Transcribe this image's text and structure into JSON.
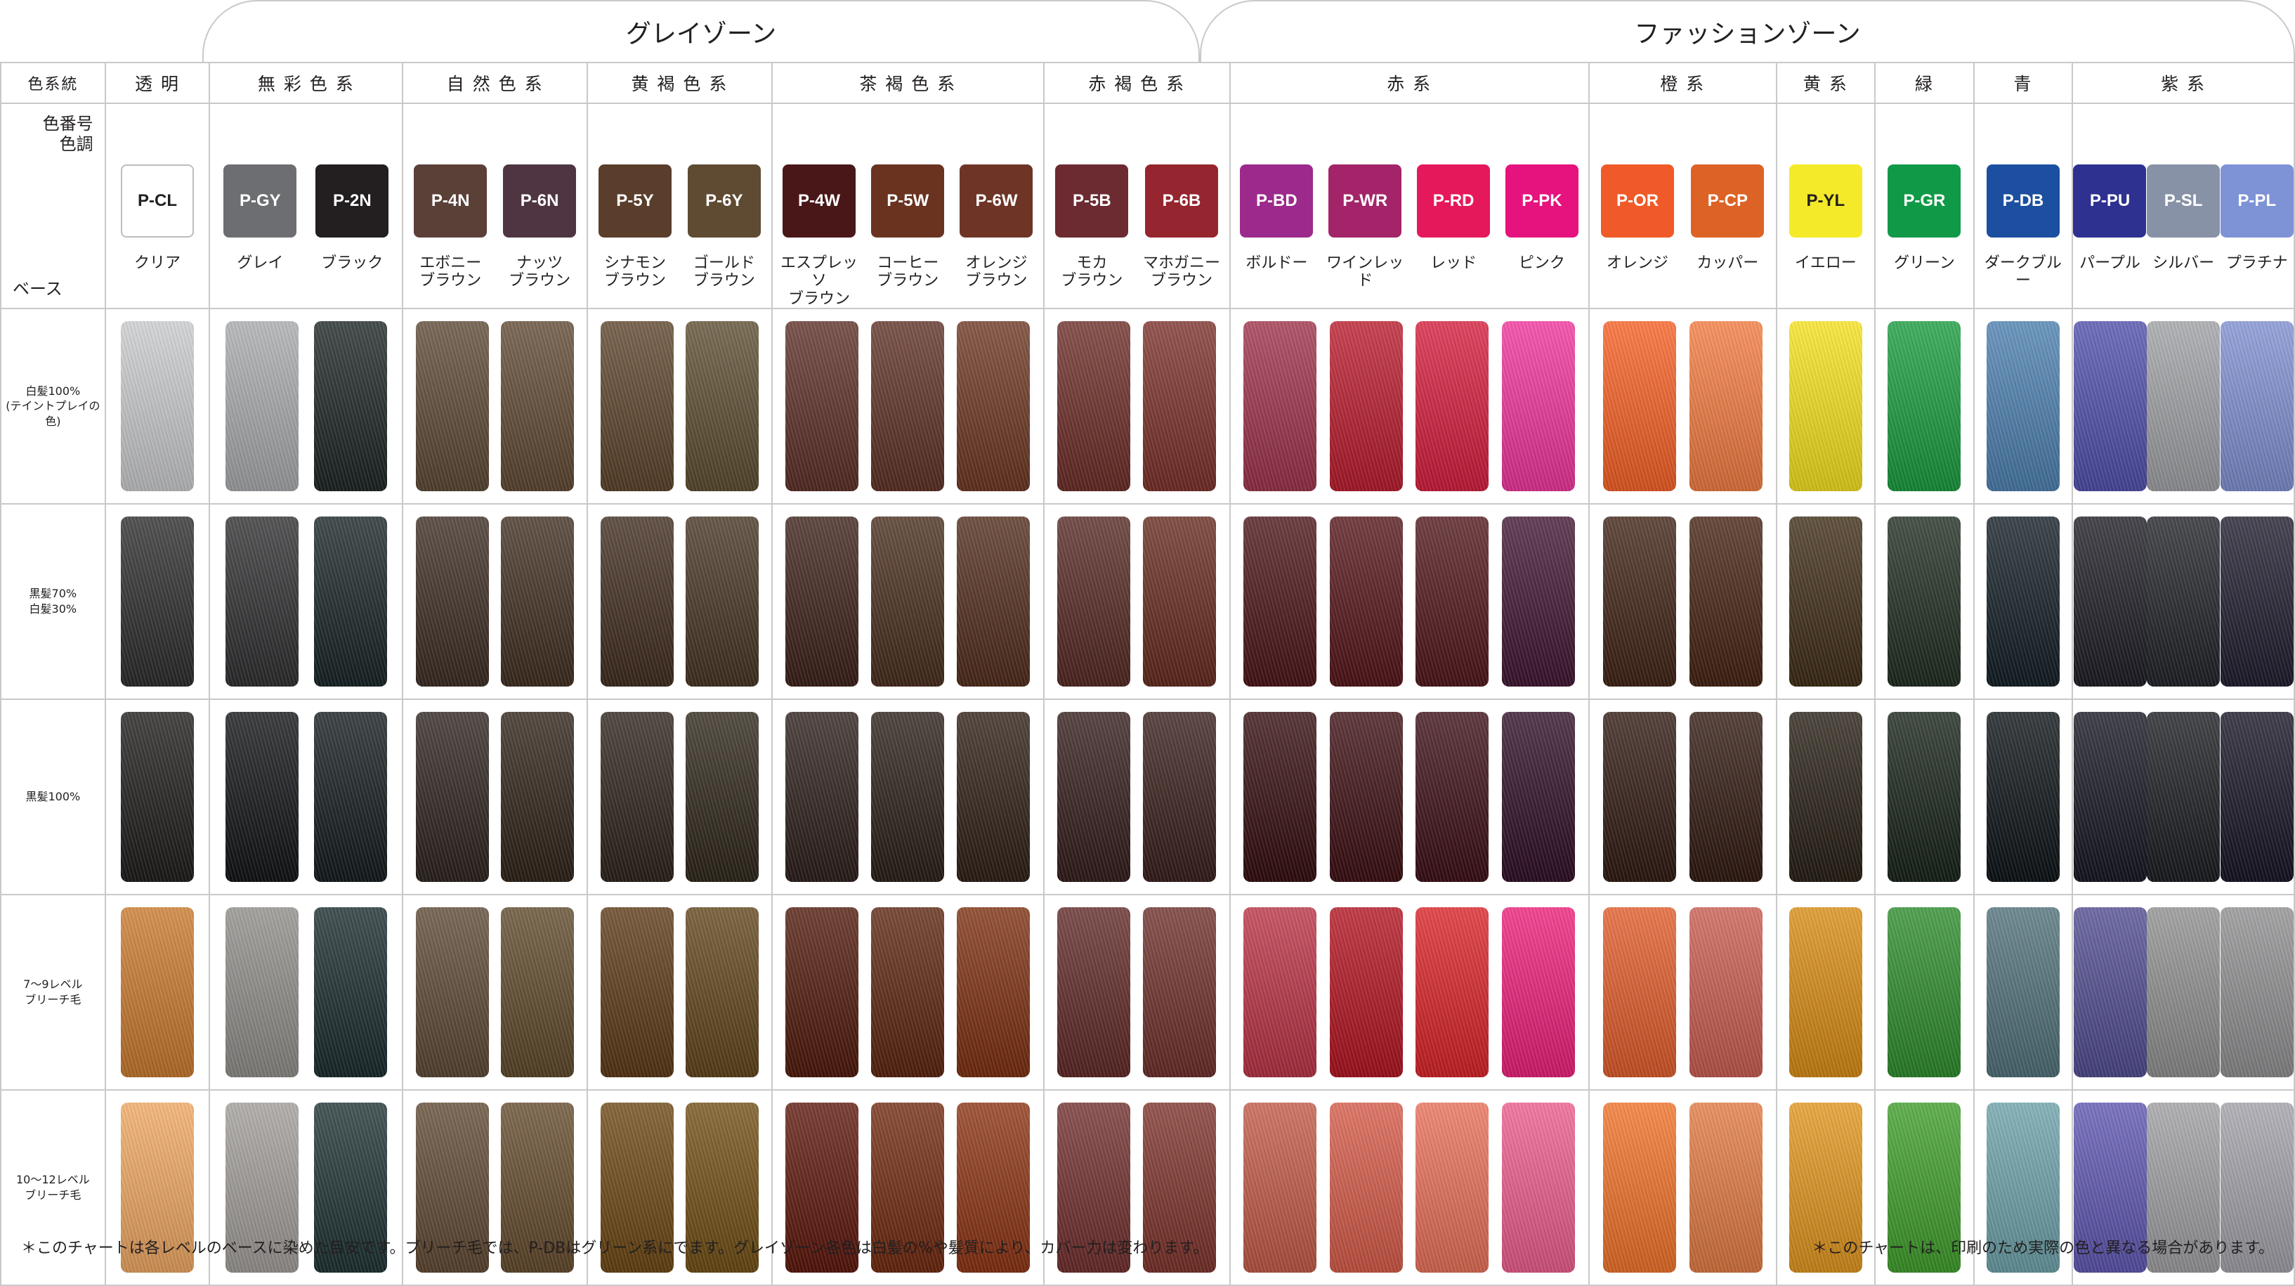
{
  "zones": {
    "gray": "グレイゾーン",
    "fashion": "ファッションゾーン"
  },
  "header": {
    "col_label": "色系統",
    "code_label_1": "色番号",
    "code_label_2": "色調",
    "base_label": "ベース"
  },
  "groups": [
    {
      "name": "透 明",
      "items": [
        {
          "code": "P-CL",
          "name": "クリア",
          "color": "#ffffff"
        }
      ]
    },
    {
      "name": "無 彩 色 系",
      "items": [
        {
          "code": "P-GY",
          "name": "グレイ",
          "color": "#6d6e71"
        },
        {
          "code": "P-2N",
          "name": "ブラック",
          "color": "#231f20"
        }
      ]
    },
    {
      "name": "自 然 色 系",
      "items": [
        {
          "code": "P-4N",
          "name": "エボニー\nブラウン",
          "color": "#5b4038"
        },
        {
          "code": "P-6N",
          "name": "ナッツ\nブラウン",
          "color": "#4f3542"
        }
      ]
    },
    {
      "name": "黄 褐 色 系",
      "items": [
        {
          "code": "P-5Y",
          "name": "シナモン\nブラウン",
          "color": "#5a3d2b"
        },
        {
          "code": "P-6Y",
          "name": "ゴールド\nブラウン",
          "color": "#5f4a32"
        }
      ]
    },
    {
      "name": "茶 褐 色 系",
      "items": [
        {
          "code": "P-4W",
          "name": "エスプレッソ\nブラウン",
          "color": "#4a1718"
        },
        {
          "code": "P-5W",
          "name": "コーヒー\nブラウン",
          "color": "#6a3320"
        },
        {
          "code": "P-6W",
          "name": "オレンジ\nブラウン",
          "color": "#6e3526"
        }
      ]
    },
    {
      "name": "赤 褐 色 系",
      "items": [
        {
          "code": "P-5B",
          "name": "モカ\nブラウン",
          "color": "#6c2a31"
        },
        {
          "code": "P-6B",
          "name": "マホガニー\nブラウン",
          "color": "#95252e"
        }
      ]
    },
    {
      "name": "赤 系",
      "items": [
        {
          "code": "P-BD",
          "name": "ボルドー",
          "color": "#9c2a8c"
        },
        {
          "code": "P-WR",
          "name": "ワインレッド",
          "color": "#a4246a"
        },
        {
          "code": "P-RD",
          "name": "レッド",
          "color": "#e5185b"
        },
        {
          "code": "P-PK",
          "name": "ピンク",
          "color": "#e6127e"
        }
      ]
    },
    {
      "name": "橙 系",
      "items": [
        {
          "code": "P-OR",
          "name": "オレンジ",
          "color": "#ef5a28"
        },
        {
          "code": "P-CP",
          "name": "カッパー",
          "color": "#dc6226"
        }
      ]
    },
    {
      "name": "黄 系",
      "items": [
        {
          "code": "P-YL",
          "name": "イエロー",
          "color": "#f4ea2a"
        }
      ]
    },
    {
      "name": "緑",
      "items": [
        {
          "code": "P-GR",
          "name": "グリーン",
          "color": "#109a47"
        }
      ]
    },
    {
      "name": "青",
      "items": [
        {
          "code": "P-DB",
          "name": "ダークブルー",
          "color": "#1c4fa0"
        }
      ]
    },
    {
      "name": "紫 系",
      "items": [
        {
          "code": "P-PU",
          "name": "パープル",
          "color": "#2e3190"
        },
        {
          "code": "P-SL",
          "name": "シルバー",
          "color": "#8792a6"
        },
        {
          "code": "P-PL",
          "name": "プラチナ",
          "color": "#7e92d6"
        }
      ]
    }
  ],
  "bases": [
    {
      "label": "白髪100%\n(テイントプレイの色)",
      "colors": [
        "#c9cacc",
        "#a7a9ac",
        "#1a2322",
        "#5a4632",
        "#5e4630",
        "#5a4128",
        "#5b4a2e",
        "#5a2d24",
        "#5c2e22",
        "#6b3420",
        "#6a2a24",
        "#7a2e28",
        "#9c3048",
        "#b8182a",
        "#d41a3a",
        "#f0329a",
        "#f65e22",
        "#f27a3e",
        "#f5e01a",
        "#169a3c",
        "#4a7eae",
        "#4e4caa",
        "#9fa0a4",
        "#7e8ed0"
      ]
    },
    {
      "label": "黒髪70%\n白髪30%",
      "colors": [
        "#2a2a2a",
        "#2d2d2f",
        "#162224",
        "#3a2a22",
        "#3e2c1e",
        "#3e2a1c",
        "#443220",
        "#3a1e16",
        "#462a1a",
        "#4e2a18",
        "#532620",
        "#63281c",
        "#4a1216",
        "#521216",
        "#4e1418",
        "#3e1430",
        "#3e2012",
        "#42200f",
        "#3c2a12",
        "#1d2a1e",
        "#101c22",
        "#1a1a22",
        "#1e2026",
        "#1e1a2c"
      ]
    },
    {
      "label": "黒髪100%",
      "colors": [
        "#1c1a18",
        "#0f1114",
        "#12191b",
        "#2b211c",
        "#2c2016",
        "#2a2018",
        "#2c2418",
        "#2a1c18",
        "#281c16",
        "#2c1c14",
        "#301a18",
        "#361c18",
        "#320a0c",
        "#3a0c10",
        "#3a0c14",
        "#2e0c24",
        "#2e1610",
        "#2e160e",
        "#241c12",
        "#142016",
        "#0a1014",
        "#141420",
        "#181a1e",
        "#141222"
      ]
    },
    {
      "label": "7〜9レベル\nブリーチ毛",
      "colors": [
        "#c8782a",
        "#8e8c88",
        "#17292c",
        "#5a4632",
        "#5c4628",
        "#5a3614",
        "#5e4218",
        "#4e1608",
        "#5a220c",
        "#7a2c0c",
        "#5e2624",
        "#6c2c28",
        "#b83042",
        "#b0101e",
        "#d82024",
        "#ec1c78",
        "#e05a28",
        "#c85a4e",
        "#d88a10",
        "#2a8a2a",
        "#4e6e78",
        "#4e4a8e",
        "#8e8e8e",
        "#8e8e90"
      ]
    },
    {
      "label": "10〜12レベル\nブリーチ毛",
      "colors": [
        "#eea660",
        "#a09c98",
        "#1c3032",
        "#5e4630",
        "#62482a",
        "#6a4410",
        "#6e4c12",
        "#5a1408",
        "#6e260c",
        "#8a3010",
        "#6e2c2a",
        "#7c3028",
        "#c05844",
        "#d45846",
        "#e86e56",
        "#ec5a8c",
        "#f07026",
        "#e07840",
        "#e0941a",
        "#3c9c28",
        "#6aa0a8",
        "#5c54b0",
        "#9e9ea2",
        "#a0a0a8"
      ]
    }
  ],
  "notes": {
    "left": "＊このチャートは各レベルのベースに染めた目安です。ブリーチ毛では、P-DBはグリーン系にでます。グレイゾーン各色は白髪の%や髪質により、カバー力は変わります。",
    "right": "＊このチャートは、印刷のため実際の色と異なる場合があります。"
  }
}
